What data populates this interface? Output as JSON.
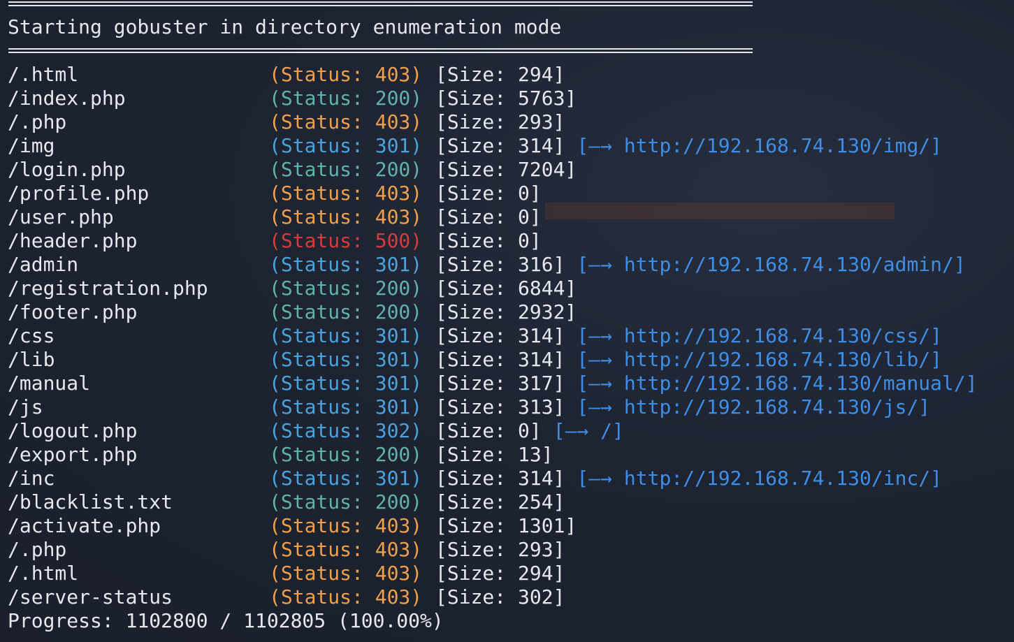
{
  "header": {
    "title": "Starting gobuster in directory enumeration mode"
  },
  "results": [
    {
      "path": "/.html",
      "status": "(Status: 403)",
      "code": "403",
      "size": "[Size: 294]",
      "redirect": ""
    },
    {
      "path": "/index.php",
      "status": "(Status: 200)",
      "code": "200",
      "size": "[Size: 5763]",
      "redirect": ""
    },
    {
      "path": "/.php",
      "status": "(Status: 403)",
      "code": "403",
      "size": "[Size: 293]",
      "redirect": ""
    },
    {
      "path": "/img",
      "status": "(Status: 301)",
      "code": "301",
      "size": "[Size: 314]",
      "redirect": "[—→ http://192.168.74.130/img/]"
    },
    {
      "path": "/login.php",
      "status": "(Status: 200)",
      "code": "200",
      "size": "[Size: 7204]",
      "redirect": ""
    },
    {
      "path": "/profile.php",
      "status": "(Status: 403)",
      "code": "403",
      "size": "[Size: 0]",
      "redirect": ""
    },
    {
      "path": "/user.php",
      "status": "(Status: 403)",
      "code": "403",
      "size": "[Size: 0]",
      "redirect": ""
    },
    {
      "path": "/header.php",
      "status": "(Status: 500)",
      "code": "500",
      "size": "[Size: 0]",
      "redirect": ""
    },
    {
      "path": "/admin",
      "status": "(Status: 301)",
      "code": "301",
      "size": "[Size: 316]",
      "redirect": "[—→ http://192.168.74.130/admin/]"
    },
    {
      "path": "/registration.php",
      "status": "(Status: 200)",
      "code": "200",
      "size": "[Size: 6844]",
      "redirect": ""
    },
    {
      "path": "/footer.php",
      "status": "(Status: 200)",
      "code": "200",
      "size": "[Size: 2932]",
      "redirect": ""
    },
    {
      "path": "/css",
      "status": "(Status: 301)",
      "code": "301",
      "size": "[Size: 314]",
      "redirect": "[—→ http://192.168.74.130/css/]"
    },
    {
      "path": "/lib",
      "status": "(Status: 301)",
      "code": "301",
      "size": "[Size: 314]",
      "redirect": "[—→ http://192.168.74.130/lib/]"
    },
    {
      "path": "/manual",
      "status": "(Status: 301)",
      "code": "301",
      "size": "[Size: 317]",
      "redirect": "[—→ http://192.168.74.130/manual/]"
    },
    {
      "path": "/js",
      "status": "(Status: 301)",
      "code": "301",
      "size": "[Size: 313]",
      "redirect": "[—→ http://192.168.74.130/js/]"
    },
    {
      "path": "/logout.php",
      "status": "(Status: 302)",
      "code": "302",
      "size": "[Size: 0]",
      "redirect": "[—→ /]"
    },
    {
      "path": "/export.php",
      "status": "(Status: 200)",
      "code": "200",
      "size": "[Size: 13]",
      "redirect": ""
    },
    {
      "path": "/inc",
      "status": "(Status: 301)",
      "code": "301",
      "size": "[Size: 314]",
      "redirect": "[—→ http://192.168.74.130/inc/]"
    },
    {
      "path": "/blacklist.txt",
      "status": "(Status: 200)",
      "code": "200",
      "size": "[Size: 254]",
      "redirect": ""
    },
    {
      "path": "/activate.php",
      "status": "(Status: 403)",
      "code": "403",
      "size": "[Size: 1301]",
      "redirect": ""
    },
    {
      "path": "/.php",
      "status": "(Status: 403)",
      "code": "403",
      "size": "[Size: 293]",
      "redirect": ""
    },
    {
      "path": "/.html",
      "status": "(Status: 403)",
      "code": "403",
      "size": "[Size: 294]",
      "redirect": ""
    },
    {
      "path": "/server-status",
      "status": "(Status: 403)",
      "code": "403",
      "size": "[Size: 302]",
      "redirect": ""
    }
  ],
  "footer": {
    "progress": "Progress: 1102800 / 1102805 (100.00%)"
  },
  "colors": {
    "background": "#1c2230",
    "text": "#e6e8ee",
    "status_200": "#5fb3a8",
    "status_301": "#4aa3dc",
    "status_302": "#4aa3dc",
    "status_403": "#f0a04b",
    "status_500": "#d93a3a",
    "redirect": "#3f8ee6"
  }
}
